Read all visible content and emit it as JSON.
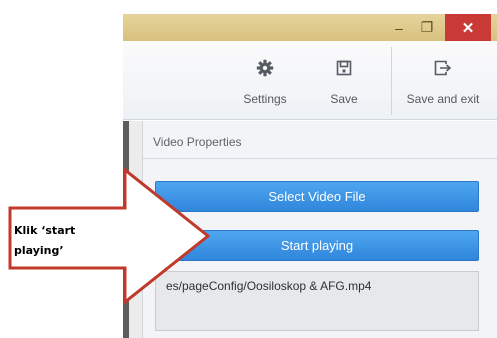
{
  "window": {
    "minimize_glyph": "–",
    "maximize_glyph": "❐",
    "close_glyph": "✕"
  },
  "toolbar": {
    "settings_label": "Settings",
    "save_label": "Save",
    "save_exit_label": "Save and exit",
    "settings_icon": "gear-icon",
    "save_icon": "floppy-disk-icon",
    "save_exit_icon": "exit-icon"
  },
  "panel": {
    "title": "Video Properties",
    "select_button": "Select Video File",
    "start_button": "Start playing",
    "file_path": "es/pageConfig/Oosiloskop & AFG.mp4"
  },
  "callout": {
    "text": "Klik ‘start playing’",
    "border_color": "#c0392b"
  },
  "colors": {
    "accent": "#3a92e4",
    "title_bar": "#dfc98c",
    "close": "#c93a37"
  }
}
